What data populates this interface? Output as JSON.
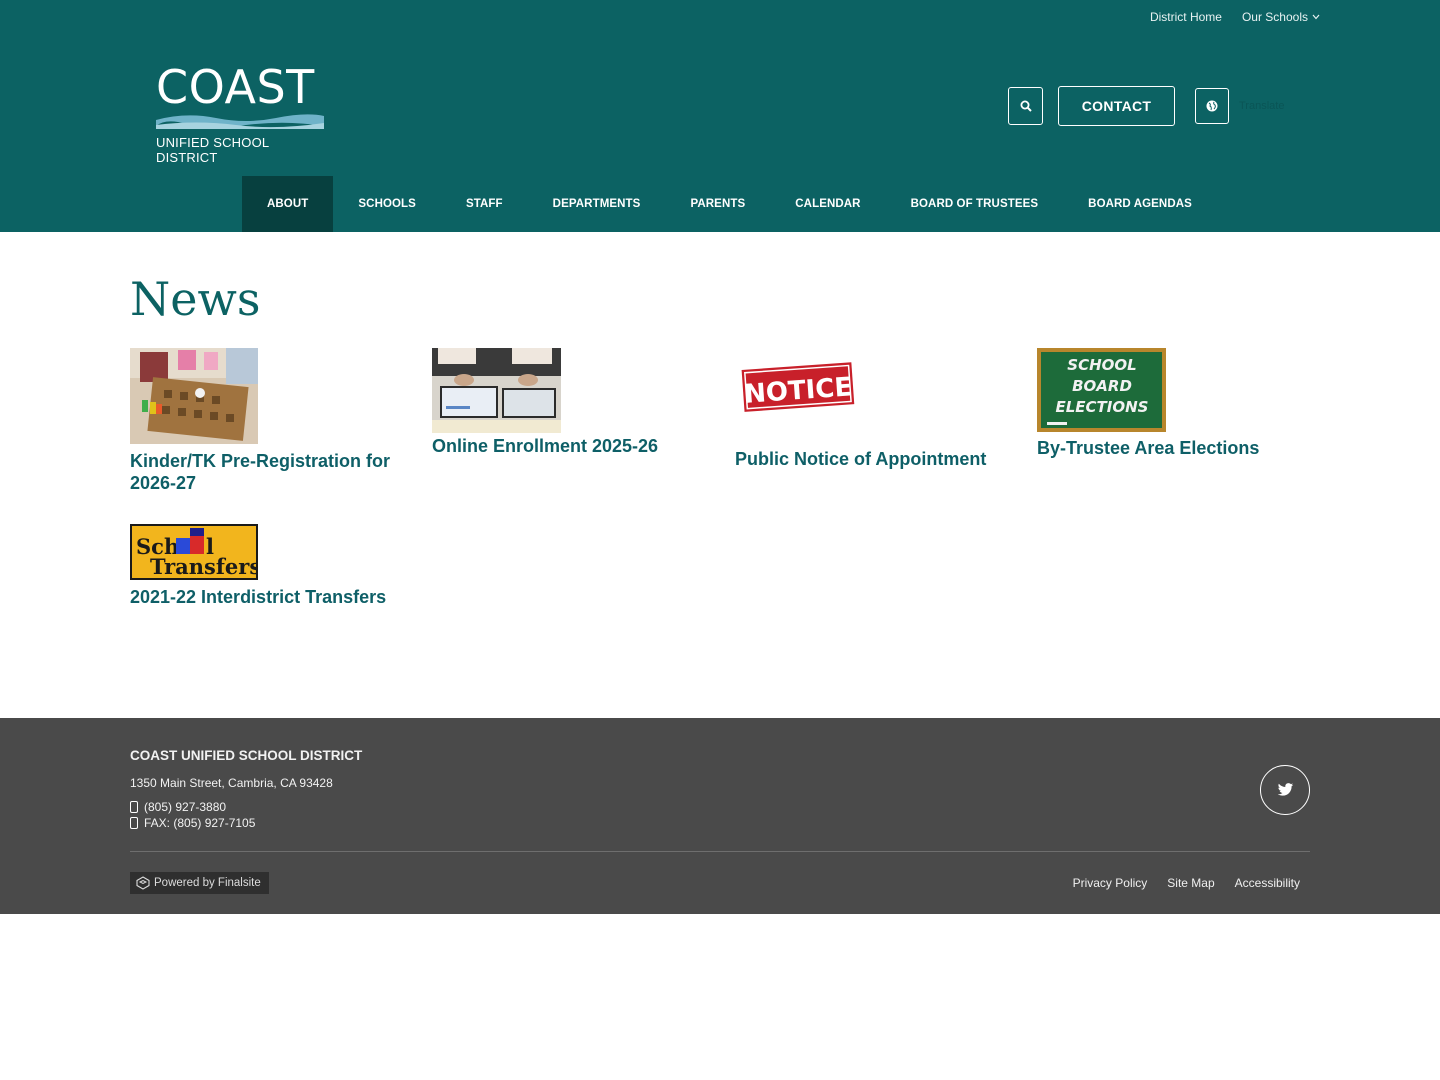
{
  "utility_nav": {
    "district_home": "District Home",
    "our_schools": "Our Schools"
  },
  "logo": {
    "name": "COAST",
    "subtitle": "UNIFIED SCHOOL DISTRICT"
  },
  "header_tools": {
    "contact_label": "CONTACT",
    "translate_label": "Translate"
  },
  "main_nav": [
    {
      "label": "ABOUT",
      "active": true
    },
    {
      "label": "SCHOOLS"
    },
    {
      "label": "STAFF"
    },
    {
      "label": "DEPARTMENTS"
    },
    {
      "label": "PARENTS"
    },
    {
      "label": "CALENDAR"
    },
    {
      "label": "BOARD OF TRUSTEES"
    },
    {
      "label": "BOARD AGENDAS"
    }
  ],
  "page": {
    "title": "News"
  },
  "news": [
    {
      "title": "Kinder/TK Pre-Registration for 2026-27"
    },
    {
      "title": "Online Enrollment 2025-26"
    },
    {
      "title": "Public Notice of Appointment",
      "image_text": "NOTICE"
    },
    {
      "title": "By-Trustee Area Elections",
      "image_text": [
        "SCHOOL",
        "BOARD",
        "ELECTIONS"
      ]
    },
    {
      "title": "2021-22 Interdistrict Transfers",
      "image_text": [
        "Sch",
        "l",
        "Transfers"
      ]
    }
  ],
  "footer": {
    "name": "COAST UNIFIED SCHOOL DISTRICT",
    "address": "1350 Main Street, Cambria, CA 93428",
    "phone": "(805) 927-3880",
    "fax": "FAX: (805) 927-7105",
    "powered_by": "Powered by Finalsite",
    "links": [
      "Privacy Policy",
      "Site Map",
      "Accessibility"
    ]
  },
  "colors": {
    "header_bg": "#0c6263",
    "nav_active_bg": "#07403f",
    "footer_bg": "#4a4a4a",
    "link_color": "#0e5f67"
  }
}
